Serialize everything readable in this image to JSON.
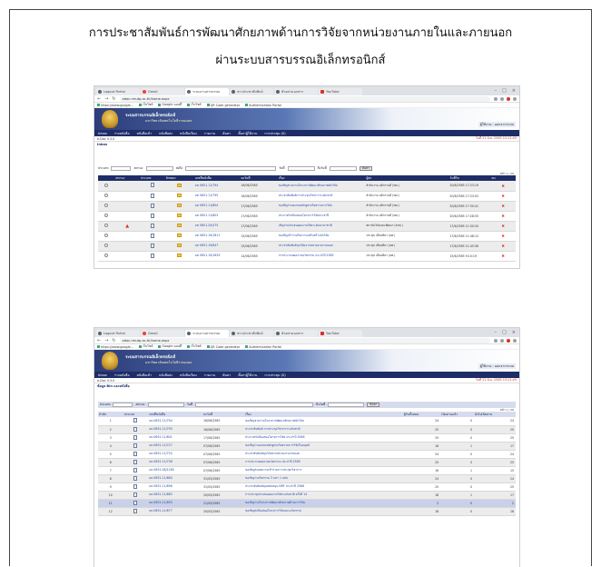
{
  "document": {
    "title_line1": "การประชาสัมพันธ์การพัฒนาศักยภาพด้านการวิจัยจากหน่วยงานภายในและภายนอก",
    "title_line2": "ผ่านระบบสารบรรณอิเล็กทรอนิกส์"
  },
  "browser": {
    "tabs": [
      "Logout Portal",
      "Gmail",
      "ระบบงานสารบรรณ",
      "ข่าวประชาสัมพันธ์",
      "ตัวอย่างเอกสาร",
      "YouTube"
    ],
    "url": "edoc.rmutp.ac.th/home.aspx",
    "bookmarks": [
      "https://www.google...",
      "เว็บไซต์",
      "Google แผนที่",
      "เว็บไซต์",
      "QR Code generator",
      "Authentication Portal"
    ],
    "window_controls": [
      "–",
      "□",
      "×"
    ]
  },
  "site": {
    "system_name": "ระบบสารบรรณอิเล็กทรอนิกส์",
    "system_subtitle": "มหาวิทยาลัยเทคโนโลยีราชมงคล",
    "user_text": "ผู้ใช้งาน : ออกจากระบบ",
    "menu": [
      "Inbox",
      "ร่างหนังสือ",
      "หนังสือเข้า",
      "หนังสือส่ง",
      "หนังสือเวียน",
      "รายงาน",
      "ค้นหา",
      "ตั้งค่าผู้ใช้งาน",
      "การประชุม (0)"
    ],
    "version": "e-Doc V.3.0",
    "datetime": "วันที่ 21 มิ.ย. 2565 15:21:45"
  },
  "shot1": {
    "breadcrumb": "Inbox",
    "search": {
      "label_type": "ประเภท",
      "label_status": "สถานะ",
      "label_from": "ส่งถึง",
      "label_date": "วันที่",
      "label_to": "ถึงวันที่",
      "search_button": "ค้นหา"
    },
    "pager": "หน้า 1 / 26",
    "columns": [
      "",
      "สถานะ",
      "ประเภท",
      "ลักษณะ",
      "เลขที่หนังสือ",
      "ลงวันที่",
      "เรื่อง",
      "ผู้ส่ง",
      "วันที่รับ",
      "ลบ"
    ],
    "rows": [
      {
        "no": "",
        "status": "",
        "number": "มท 0651.11/794",
        "date": "16/06/2565",
        "subject": "ขอเชิญชวนร่วมโครงการพัฒนาศักยภาพนักวิจัย",
        "sender": "สำนักงาน อธิการบดี (ทศ.)",
        "received": "20/6/2565 17:23:19"
      },
      {
        "no": "",
        "status": "",
        "number": "มท 0651.11/795",
        "date": "16/06/2565",
        "subject": "ประชาสัมพันธ์การประชุมวิชาการระดับชาติ",
        "sender": "สำนักงาน อธิการบดี (ทศ.)",
        "received": "20/6/2565 17:23:52"
      },
      {
        "no": "",
        "status": "",
        "number": "มท 0651.11/804",
        "date": "17/06/2565",
        "subject": "ขอเชิญร่วมอบรมหลักสูตรจริยธรรมการวิจัย",
        "sender": "สำนักงาน อธิการบดี (ทศ.)",
        "received": "20/6/2565 17:30:41"
      },
      {
        "no": "",
        "status": "",
        "number": "มท 0651.11/803",
        "date": "17/06/2565",
        "subject": "ประกาศรับข้อเสนอโครงการวิจัยประจำปี",
        "sender": "สำนักงาน อธิการบดี (ทศ.)",
        "received": "20/6/2565 17:28:55"
      },
      {
        "no": "",
        "status": "warn",
        "number": "มท 0651.20/475",
        "date": "17/06/2565",
        "subject": "เชิญร่วมนำเสนอผลงานวิจัยระดับนานาชาติ",
        "sender": "สถาบันวิจัยและพัฒนา (สวพ.)",
        "received": "17/6/2565 11:50:34"
      },
      {
        "no": "",
        "status": "",
        "number": "มท 0651.19/1811",
        "date": "15/06/2565",
        "subject": "ขอเชิญเข้าร่วมกิจกรรมเสริมสร้างนักวิจัย",
        "sender": "ประชุม เลี่ยมศิลา (อพ.)",
        "received": "17/6/2565 11:48:12"
      },
      {
        "no": "",
        "status": "",
        "number": "มท 0651.19/847",
        "date": "15/06/2565",
        "subject": "ประชาสัมพันธ์ทุนวิจัยจากหน่วยงานภายนอก",
        "sender": "ประชุม เลี่ยมศิลา (อพ.)",
        "received": "17/6/2565 11:45:56"
      },
      {
        "no": "",
        "status": "",
        "number": "มท 0651.19/1629",
        "date": "14/06/2565",
        "subject": "การประกวดผลงานนวัตกรรม ประจำปี 2565",
        "sender": "ประชุม เลี่ยมศิลา (อพ.)",
        "received": "15/6/2565 9:10:19"
      }
    ]
  },
  "shot2": {
    "breadcrumb": "ข้อมูล Bin และหนังสือ",
    "search": {
      "label_type": "ประเภท",
      "label_status": "สถานะ",
      "label_date": "วันที่",
      "label_to": "ถึงวันที่",
      "search_button": "ค้นหา"
    },
    "pager": "หน้า 1 / 26",
    "columns": [
      "ลำดับ",
      "ประเภท",
      "เลขที่หนังสือ",
      "ลงวันที่",
      "เรื่อง",
      "ผู้รับทั้งหมด",
      "เปิดอ่านแล้ว",
      "ยังไม่เปิดอ่าน"
    ],
    "rows": [
      {
        "no": "1",
        "number": "มท 0651.11/794",
        "date": "16/06/2565",
        "subject": "ขอเชิญชวนร่วมโครงการพัฒนาศักยภาพนักวิจัย",
        "total": "24",
        "read": "0",
        "unread": "24"
      },
      {
        "no": "2",
        "number": "มท 0651.11/795",
        "date": "16/06/2565",
        "subject": "ประชาสัมพันธ์ การประชุมวิชาการระดับชาติ",
        "total": "25",
        "read": "0",
        "unread": "25"
      },
      {
        "no": "3",
        "number": "มท 0651.11/801",
        "date": "17/06/2565",
        "subject": "ประกาศรับข้อเสนอโครงการวิจัย ประจำปี 2566",
        "total": "25",
        "read": "0",
        "unread": "25"
      },
      {
        "no": "4",
        "number": "มท 0651.11/727",
        "date": "07/06/2565",
        "subject": "ขอเชิญร่วมอบรมหลักสูตรจริยธรรมการวิจัยในมนุษย์",
        "total": "18",
        "read": "1",
        "unread": "17"
      },
      {
        "no": "5",
        "number": "มท 0651.11/720",
        "date": "07/06/2565",
        "subject": "ประชาสัมพันธ์ทุนวิจัยจากหน่วยงานภายนอก",
        "total": "24",
        "read": "0",
        "unread": "24"
      },
      {
        "no": "6",
        "number": "มท 0651.11/738",
        "date": "07/06/2565",
        "subject": "การประกวดผลงานนวัตกรรม ประจำปี 2565",
        "total": "25",
        "read": "0",
        "unread": "25"
      },
      {
        "no": "7",
        "number": "มท 0651.08/1265",
        "date": "07/06/2565",
        "subject": "ขอเชิญส่งบทความเข้าร่วมการประชุมวิชาการ",
        "total": "16",
        "read": "1",
        "unread": "15"
      },
      {
        "no": "8",
        "number": "มท 0651.11/684",
        "date": "31/05/2565",
        "subject": "ขอเชิญร่วมกิจกรรม 3 มหา 1 ฉบับ",
        "total": "24",
        "read": "0",
        "unread": "24"
      },
      {
        "no": "9",
        "number": "มท 0651.11/698",
        "date": "31/05/2565",
        "subject": "ประชาสัมพันธ์ทุนสนับสนุน NRF ประจำปี 2566",
        "total": "25",
        "read": "0",
        "unread": "25"
      },
      {
        "no": "10",
        "number": "มท 0651.11/683",
        "date": "20/05/2565",
        "subject": "การประชุมนำเสนอผลงานวิจัยระดับชาติ ครั้งที่ 14",
        "total": "18",
        "read": "1",
        "unread": "17"
      },
      {
        "no": "11",
        "number": "มท 0651.11/655",
        "date": "21/05/2565",
        "subject": "ขอเชิญร่วมโครงการพัฒนาศักยภาพด้านการวิจัย",
        "total": "2",
        "read": "0",
        "unread": "2"
      },
      {
        "no": "12",
        "number": "มท 0651.11/677",
        "date": "20/05/2565",
        "subject": "ขอเชิญส่งข้อเสนอโครงการวิจัยและนวัตกรรม",
        "total": "16",
        "read": "0",
        "unread": "16"
      }
    ]
  }
}
